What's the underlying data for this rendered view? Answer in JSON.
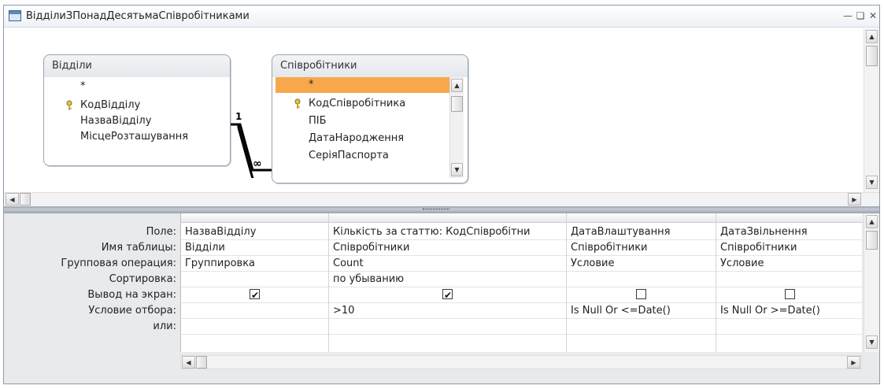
{
  "window": {
    "title": "ВідділиЗПонадДесятьмаСпівробітниками"
  },
  "tables": [
    {
      "name": "Відділи",
      "fields": [
        "*",
        "КодВідділу",
        "НазваВідділу",
        "МісцеРозташування"
      ]
    },
    {
      "name": "Співробітники",
      "fields": [
        "*",
        "КодСпівробітника",
        "ПІБ",
        "ДатаНародження",
        "СеріяПаспорта"
      ]
    }
  ],
  "relation": {
    "one_label": "1",
    "many_label": "∞"
  },
  "grid": {
    "row_labels": [
      "Поле:",
      "Имя таблицы:",
      "Групповая операция:",
      "Сортировка:",
      "Вывод на экран:",
      "Условие отбора:",
      "или:"
    ],
    "columns": [
      {
        "field": "НазваВідділу",
        "table": "Відділи",
        "group": "Группировка",
        "sort": "",
        "show": true,
        "criteria": ""
      },
      {
        "field": "Кількість за статтю: КодСпівробітни",
        "table": "Співробітники",
        "group": "Count",
        "sort": "по убыванию",
        "show": true,
        "criteria": ">10"
      },
      {
        "field": "ДатаВлаштування",
        "table": "Співробітники",
        "group": "Условие",
        "sort": "",
        "show": false,
        "criteria": "Is Null Or <=Date()"
      },
      {
        "field": "ДатаЗвільнення",
        "table": "Співробітники",
        "group": "Условие",
        "sort": "",
        "show": false,
        "criteria": "Is Null Or >=Date()"
      }
    ]
  },
  "icons": {
    "minimize": "minimize-icon",
    "restore": "restore-icon",
    "close": "close-icon",
    "key": "primary-key-icon",
    "scroll_up": "scroll-up-arrow",
    "scroll_down": "scroll-down-arrow"
  },
  "colors": {
    "selected_field": "#f7a84a",
    "window_border": "#8c9aae",
    "splitter": "#9aa2ae"
  }
}
